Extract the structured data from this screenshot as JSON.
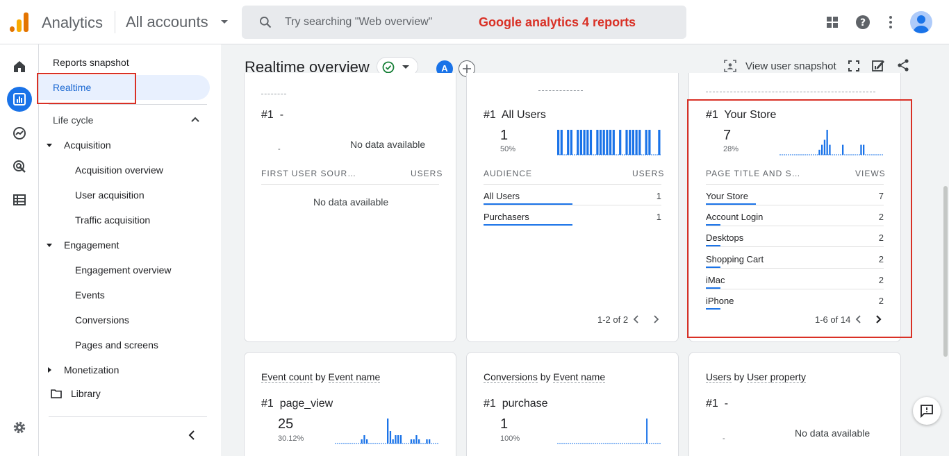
{
  "header": {
    "app_name": "Analytics",
    "account_selector": "All accounts",
    "search_placeholder": "Try searching \"Web overview\"",
    "overlay_caption": "Google analytics 4 reports",
    "colors": {
      "accent": "#1a73e8",
      "logo_orange": "#f9ab00",
      "logo_dark": "#e37400",
      "annotation_red": "#d93025"
    }
  },
  "rail": {
    "icons": [
      "home-icon",
      "reports-icon",
      "explore-icon",
      "advertising-icon",
      "configure-icon",
      "admin-gear-icon"
    ]
  },
  "nav": {
    "reports_snapshot": "Reports snapshot",
    "realtime": "Realtime",
    "life_cycle": "Life cycle",
    "acquisition": "Acquisition",
    "acquisition_overview": "Acquisition overview",
    "user_acquisition": "User acquisition",
    "traffic_acquisition": "Traffic acquisition",
    "engagement": "Engagement",
    "engagement_overview": "Engagement overview",
    "events": "Events",
    "conversions": "Conversions",
    "pages_and_screens": "Pages and screens",
    "monetization": "Monetization",
    "library": "Library"
  },
  "page": {
    "title": "Realtime overview",
    "compare_badge": "A",
    "view_user_snapshot": "View user snapshot"
  },
  "cards": {
    "source": {
      "rank": "#1",
      "rank_value": "-",
      "small_value": "-",
      "nodata": "No data available",
      "col1": "FIRST USER SOUR…",
      "col2": "USERS",
      "table_nodata": "No data available"
    },
    "audience": {
      "rank": "#1",
      "rank_value": "All Users",
      "big_value": "1",
      "pct": "50%",
      "col1": "AUDIENCE",
      "col2": "USERS",
      "rows": [
        {
          "label": "All Users",
          "value": "1",
          "share": 1.0
        },
        {
          "label": "Purchasers",
          "value": "1",
          "share": 1.0
        }
      ],
      "pager": "1-2 of 2",
      "sparkline": [
        1,
        1,
        0,
        1,
        1,
        0,
        1,
        1,
        1,
        1,
        1,
        0,
        1,
        1,
        1,
        1,
        1,
        1,
        0,
        1,
        0,
        1,
        1,
        1,
        1,
        1,
        0,
        1,
        1,
        0,
        0,
        1
      ]
    },
    "pages": {
      "rank": "#1",
      "rank_value": "Your Store",
      "big_value": "7",
      "pct": "28%",
      "col1": "PAGE TITLE AND S…",
      "col2": "VIEWS",
      "rows": [
        {
          "label": "Your Store",
          "value": "7",
          "share": 1.0
        },
        {
          "label": "Account Login",
          "value": "2",
          "share": 0.29
        },
        {
          "label": "Desktops",
          "value": "2",
          "share": 0.29
        },
        {
          "label": "Shopping Cart",
          "value": "2",
          "share": 0.29
        },
        {
          "label": "iMac",
          "value": "2",
          "share": 0.29
        },
        {
          "label": "iPhone",
          "value": "2",
          "share": 0.29
        }
      ],
      "pager": "1-6 of 14",
      "sparkline": [
        0,
        0,
        0,
        0,
        0,
        0,
        0,
        0,
        0,
        0,
        0,
        0,
        0,
        0,
        0,
        1,
        2,
        3,
        5,
        2,
        0,
        0,
        0,
        0,
        2,
        0,
        0,
        0,
        0,
        0,
        0,
        2,
        2,
        0,
        0,
        0,
        0,
        0,
        0,
        0
      ]
    },
    "events": {
      "title_metric": "Event count",
      "title_by": "by",
      "title_dim": "Event name",
      "rank": "#1",
      "rank_value": "page_view",
      "big_value": "25",
      "pct": "30.12%",
      "sparkline": [
        0,
        0,
        0,
        0,
        0,
        0,
        0,
        0,
        0,
        0,
        1,
        2,
        1,
        0,
        0,
        0,
        0,
        0,
        0,
        0,
        6,
        3,
        1,
        2,
        2,
        2,
        0,
        0,
        0,
        1,
        1,
        2,
        1,
        0,
        0,
        1,
        1,
        0,
        0,
        0
      ]
    },
    "conversions": {
      "title_metric": "Conversions",
      "title_by": "by",
      "title_dim": "Event name",
      "rank": "#1",
      "rank_value": "purchase",
      "big_value": "1",
      "pct": "100%",
      "sparkline": [
        0,
        0,
        0,
        0,
        0,
        0,
        0,
        0,
        0,
        0,
        0,
        0,
        0,
        0,
        0,
        0,
        0,
        0,
        0,
        0,
        0,
        0,
        0,
        0,
        0,
        0,
        0,
        0,
        0,
        0,
        0,
        0,
        0,
        0,
        0,
        0,
        0,
        0,
        0,
        0,
        0,
        5,
        0,
        0,
        0,
        0,
        0,
        0
      ]
    },
    "user_property": {
      "title_metric": "Users",
      "title_by": "by",
      "title_dim": "User property",
      "rank": "#1",
      "rank_value": "-",
      "small_value": "-",
      "nodata": "No data available"
    }
  }
}
